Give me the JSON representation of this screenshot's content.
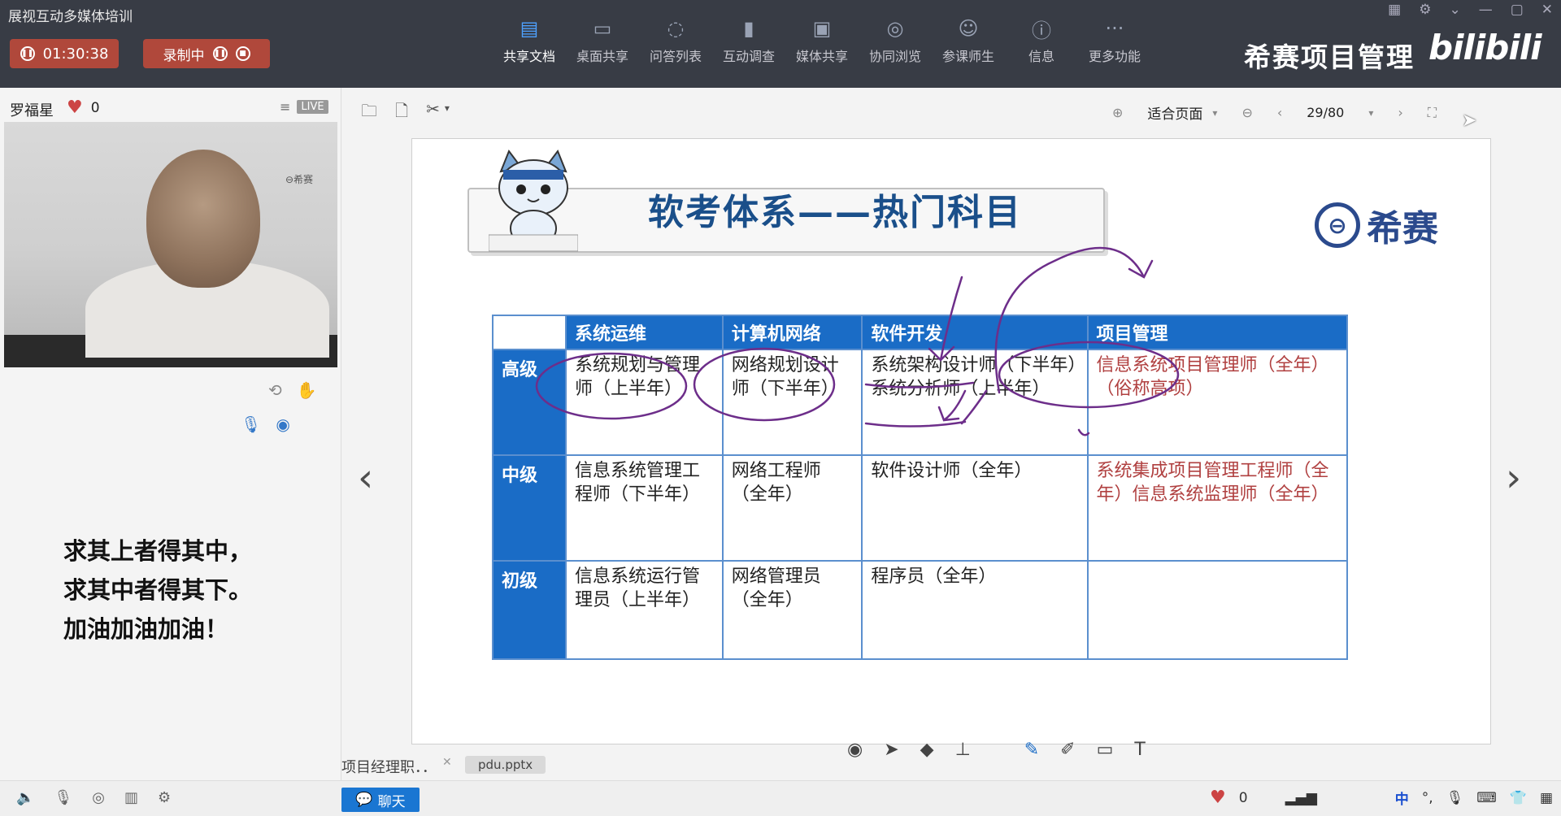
{
  "app": {
    "title": "展视互动多媒体培训"
  },
  "recording": {
    "timer": "01:30:38",
    "status_label": "录制中"
  },
  "toolbar": {
    "items": [
      {
        "label": "共享文档",
        "icon": "document-share-icon"
      },
      {
        "label": "桌面共享",
        "icon": "desktop-share-icon"
      },
      {
        "label": "问答列表",
        "icon": "qa-list-icon"
      },
      {
        "label": "互动调查",
        "icon": "survey-chart-icon"
      },
      {
        "label": "媒体共享",
        "icon": "media-film-icon"
      },
      {
        "label": "协同浏览",
        "icon": "compass-icon"
      },
      {
        "label": "参课师生",
        "icon": "people-icon"
      },
      {
        "label": "信息",
        "icon": "info-icon"
      },
      {
        "label": "更多功能",
        "icon": "more-dots-icon"
      }
    ],
    "brand": "希赛项目管理",
    "bili_logo": "bilibili"
  },
  "presenter": {
    "name": "罗福星",
    "likes": "0",
    "live_badge": "LIVE",
    "video_watermark": "⊖希赛"
  },
  "motto": {
    "line1": "求其上者得其中，",
    "line2": "求其中者得其下。",
    "line3": "加油加油加油！"
  },
  "viewer": {
    "zoom_label": "适合页面",
    "page_indicator": "29/80"
  },
  "slide": {
    "title": "软考体系——热门科目",
    "logo_text": "希赛",
    "table": {
      "headers": [
        "系统运维",
        "计算机网络",
        "软件开发",
        "项目管理"
      ],
      "rows": [
        {
          "level": "高级",
          "cells": [
            "系统规划与管理师（上半年）",
            "网络规划设计师（下半年）",
            "系统架构设计师（下半年）系统分析师（上半年）",
            "信息系统项目管理师（全年）（俗称高项）"
          ]
        },
        {
          "level": "中级",
          "cells": [
            "信息系统管理工程师（下半年）",
            "网络工程师（全年）",
            "软件设计师（全年）",
            "系统集成项目管理工程师（全年）信息系统监理师（全年）"
          ]
        },
        {
          "level": "初级",
          "cells": [
            "信息系统运行管理员（上半年）",
            "网络管理员（全年）",
            "程序员（全年）",
            ""
          ]
        }
      ]
    }
  },
  "tabs": {
    "tab1": "项目经理职．．",
    "tab2": "pdu.pptx"
  },
  "bottom": {
    "chat_label": "聊天",
    "likes": "0",
    "ime": "中"
  },
  "colors": {
    "header_blue": "#1a6cc6",
    "title_blue": "#1a4f8a",
    "recording_red": "#b0483b",
    "ink_purple": "#6d2e8a",
    "pm_text_red": "#b04040"
  }
}
